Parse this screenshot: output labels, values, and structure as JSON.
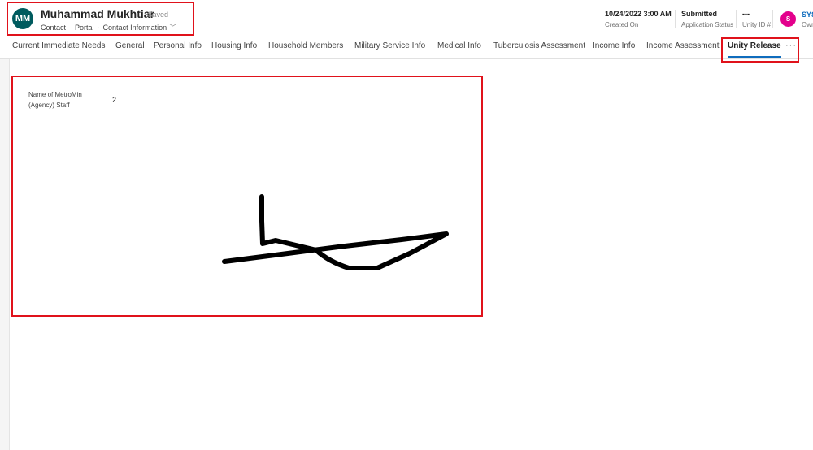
{
  "header": {
    "avatar_initials": "MM",
    "record_name": "Muhammad Mukhtiar",
    "save_status": "- Saved",
    "entity": "Contact",
    "form_group": "Portal",
    "form_name": "Contact Information",
    "fields": [
      {
        "value": "10/24/2022 3:00 AM",
        "label": "Created On"
      },
      {
        "value": "Submitted",
        "label": "Application Status"
      },
      {
        "value": "---",
        "label": "Unity ID #"
      }
    ],
    "owner": {
      "initial": "S",
      "name": "SYS",
      "label": "Own"
    }
  },
  "tabs": [
    {
      "label": "Current Immediate Needs"
    },
    {
      "label": "General"
    },
    {
      "label": "Personal Info"
    },
    {
      "label": "Housing Info"
    },
    {
      "label": "Household Members"
    },
    {
      "label": "Military Service Info"
    },
    {
      "label": "Medical Info"
    },
    {
      "label": "Tuberculosis Assessment"
    },
    {
      "label": "Income Info"
    },
    {
      "label": "Income Assessment"
    },
    {
      "label": "Unity Release",
      "active": true
    }
  ],
  "more_tabs": "···",
  "section": {
    "field_label": "Name of MetroMin (Agency) Staff",
    "field_value": "2"
  },
  "colors": {
    "accent": "#0f6cbd",
    "avatar_bg": "#005b5e",
    "owner_avatar_bg": "#e3008c",
    "highlight": "#e0121b"
  },
  "icons": {
    "form_selector": "chevron-down-icon",
    "more_tabs": "more-icon"
  }
}
